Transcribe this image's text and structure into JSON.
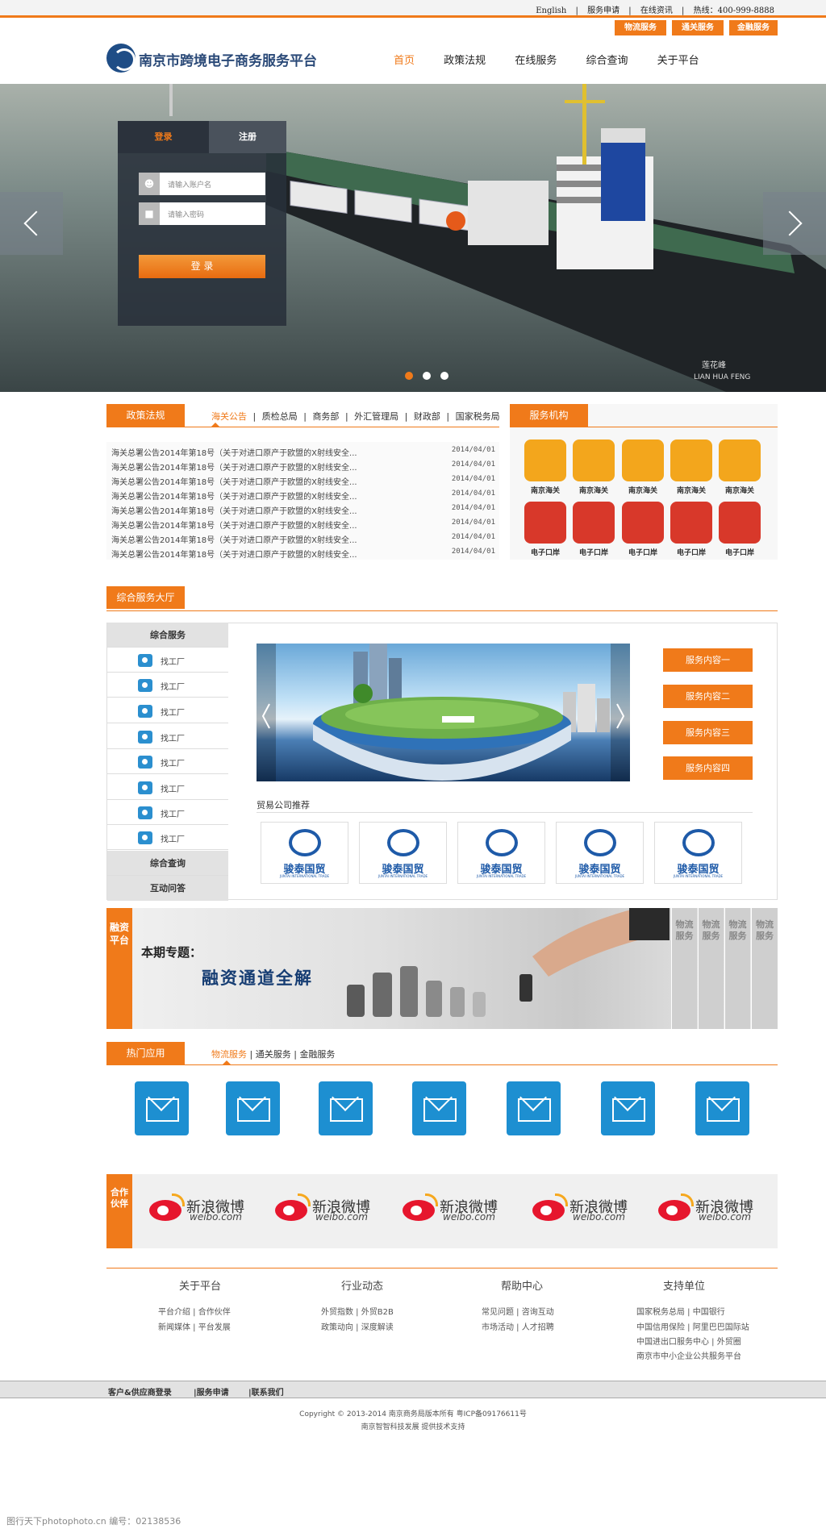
{
  "top": {
    "links": [
      "English",
      "|",
      "服务申请",
      "|",
      "在线资讯",
      "|",
      "热线：400-999-8888"
    ],
    "service_tabs": [
      "物流服务",
      "通关服务",
      "金融服务"
    ]
  },
  "header": {
    "logo_title": "南京市跨境电子商务服务平台",
    "nav": [
      "首页",
      "政策法规",
      "在线服务",
      "综合查询",
      "关于平台"
    ]
  },
  "hero": {
    "login_tab": "登录",
    "register_tab": "注册",
    "username_placeholder": "请输入账户名",
    "password_placeholder": "请输入密码",
    "login_button": "登 录",
    "ship_name": "莲花峰",
    "ship_name_en": "LIAN HUA FENG"
  },
  "policy": {
    "title": "政策法规",
    "tabs": [
      "海关公告",
      "|",
      "质检总局",
      "|",
      "商务部",
      "|",
      "外汇管理局",
      "|",
      "财政部",
      "|",
      "国家税务局"
    ],
    "items": [
      {
        "title": "海关总署公告2014年第18号（关于对进口原产于欧盟的X射线安全...",
        "date": "2014/04/01"
      },
      {
        "title": "海关总署公告2014年第18号（关于对进口原产于欧盟的X射线安全...",
        "date": "2014/04/01"
      },
      {
        "title": "海关总署公告2014年第18号（关于对进口原产于欧盟的X射线安全...",
        "date": "2014/04/01"
      },
      {
        "title": "海关总署公告2014年第18号（关于对进口原产于欧盟的X射线安全...",
        "date": "2014/04/01"
      },
      {
        "title": "海关总署公告2014年第18号（关于对进口原产于欧盟的X射线安全...",
        "date": "2014/04/01"
      },
      {
        "title": "海关总署公告2014年第18号（关于对进口原产于欧盟的X射线安全...",
        "date": "2014/04/01"
      },
      {
        "title": "海关总署公告2014年第18号（关于对进口原产于欧盟的X射线安全...",
        "date": "2014/04/01"
      },
      {
        "title": "海关总署公告2014年第18号（关于对进口原产于欧盟的X射线安全...",
        "date": "2014/04/01"
      }
    ]
  },
  "orgs": {
    "title": "服务机构",
    "row1": [
      "南京海关",
      "南京海关",
      "南京海关",
      "南京海关",
      "南京海关"
    ],
    "row2": [
      "电子口岸",
      "电子口岸",
      "电子口岸",
      "电子口岸",
      "电子口岸"
    ]
  },
  "hall": {
    "title": "综合服务大厅",
    "side_head": "综合服务",
    "side_items": [
      "找工厂",
      "找工厂",
      "找工厂",
      "找工厂",
      "找工厂",
      "找工厂",
      "找工厂",
      "找工厂"
    ],
    "side_query": "综合查询",
    "side_qa": "互动问答",
    "service_buttons": [
      "服务内容一",
      "服务内容二",
      "服务内容三",
      "服务内容四"
    ],
    "trade_title": "贸易公司推荐",
    "companies": [
      {
        "name": "骏泰国贸",
        "en": "JUNTAI INTERNATIONAL TRADE"
      },
      {
        "name": "骏泰国贸",
        "en": "JUNTAI INTERNATIONAL TRADE"
      },
      {
        "name": "骏泰国贸",
        "en": "JUNTAI INTERNATIONAL TRADE"
      },
      {
        "name": "骏泰国贸",
        "en": "JUNTAI INTERNATIONAL TRADE"
      },
      {
        "name": "骏泰国贸",
        "en": "JUNTAI INTERNATIONAL TRADE"
      }
    ]
  },
  "banner": {
    "side_label": "融资平台",
    "topic_label": "本期专题：",
    "topic_title": "融资通道全解",
    "vtabs": [
      "物流服务",
      "物流服务",
      "物流服务",
      "物流服务"
    ]
  },
  "hot": {
    "title": "热门应用",
    "tabs": [
      "物流服务",
      "|",
      "通关服务",
      "|",
      "金融服务"
    ],
    "app_count": 7
  },
  "partners": {
    "side_label": "合作伙伴",
    "logos": [
      {
        "cn": "新浪微博",
        "en": "weibo.com"
      },
      {
        "cn": "新浪微博",
        "en": "weibo.com"
      },
      {
        "cn": "新浪微博",
        "en": "weibo.com"
      },
      {
        "cn": "新浪微博",
        "en": "weibo.com"
      },
      {
        "cn": "新浪微博",
        "en": "weibo.com"
      }
    ]
  },
  "footer": {
    "columns": [
      {
        "title": "关于平台",
        "lines": [
          "平台介绍 | 合作伙伴",
          "新闻媒体 | 平台发展"
        ]
      },
      {
        "title": "行业动态",
        "lines": [
          "外贸指数 | 外贸B2B",
          "政策动向 | 深度解读"
        ]
      },
      {
        "title": "帮助中心",
        "lines": [
          "常见问题 | 咨询互动",
          "市场活动 | 人才招聘"
        ]
      },
      {
        "title": "支持单位",
        "lines": [
          "国家税务总局 | 中国银行",
          "中国信用保险 | 阿里巴巴国际站",
          "中国进出口服务中心 | 外贸圈",
          "南京市中小企业公共服务平台"
        ]
      }
    ],
    "bottom_links": [
      "客户&供应商登录",
      "|服务申请",
      "|联系我们"
    ],
    "copyright": "Copyright © 2013-2014 南京商务局版本所有 粤ICP备09176611号",
    "support": "南京智智科技发展 提供技术支持",
    "watermark": "图行天下photophoto.cn  编号：02138536"
  },
  "colors": {
    "accent": "#f07a1a",
    "navy": "#2b4a78",
    "blue_icon": "#1d8fd1",
    "org_yellow": "#f3a61c",
    "org_red": "#d8382a"
  }
}
